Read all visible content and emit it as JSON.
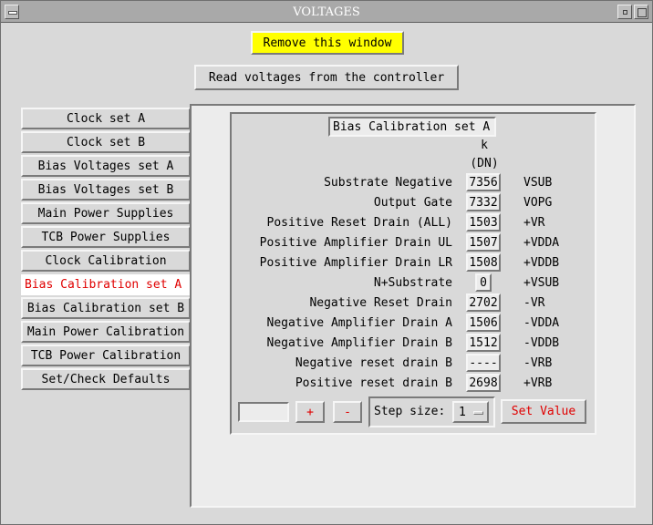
{
  "window": {
    "title": "VOLTAGES"
  },
  "toolbar": {
    "remove_label": "Remove this window",
    "remove_color": "#ffff00",
    "read_label": "Read voltages from the controller"
  },
  "tabs": [
    {
      "label": "Clock set A",
      "active": false
    },
    {
      "label": "Clock set B",
      "active": false
    },
    {
      "label": "Bias Voltages set A",
      "active": false
    },
    {
      "label": "Bias Voltages set B",
      "active": false
    },
    {
      "label": "Main Power Supplies",
      "active": false
    },
    {
      "label": "TCB Power Supplies",
      "active": false
    },
    {
      "label": "Clock Calibration",
      "active": false
    },
    {
      "label": "Bias Calibration set A",
      "active": true
    },
    {
      "label": "Bias Calibration set B",
      "active": false
    },
    {
      "label": "Main Power Calibration",
      "active": false
    },
    {
      "label": "TCB Power Calibration",
      "active": false
    },
    {
      "label": "Set/Check Defaults",
      "active": false
    }
  ],
  "panel": {
    "title": "Bias Calibration set A",
    "col_k": "k",
    "col_dn": "(DN)",
    "rows": [
      {
        "label": "Substrate Negative",
        "value": "7356",
        "signal": "VSUB"
      },
      {
        "label": "Output Gate",
        "value": "7332",
        "signal": "VOPG"
      },
      {
        "label": "Positive Reset Drain (ALL)",
        "value": "1503",
        "signal": "+VR"
      },
      {
        "label": "Positive Amplifier Drain UL",
        "value": "1507",
        "signal": "+VDDA"
      },
      {
        "label": "Positive Amplifier Drain LR",
        "value": "1508",
        "signal": "+VDDB"
      },
      {
        "label": "N+Substrate",
        "value": "0",
        "signal": "+VSUB"
      },
      {
        "label": "Negative Reset Drain",
        "value": "2702",
        "signal": "-VR"
      },
      {
        "label": "Negative Amplifier Drain A",
        "value": "1506",
        "signal": "-VDDA"
      },
      {
        "label": "Negative Amplifier Drain B",
        "value": "1512",
        "signal": "-VDDB"
      },
      {
        "label": "Negative reset drain B",
        "value": "----",
        "signal": "-VRB"
      },
      {
        "label": "Positive reset drain B",
        "value": "2698",
        "signal": "+VRB"
      }
    ]
  },
  "controls": {
    "entry_value": "",
    "plus_label": "+",
    "minus_label": "-",
    "step_label": "Step size:",
    "step_value": "1",
    "set_label": "Set Value",
    "accent_color": "#e00000"
  }
}
